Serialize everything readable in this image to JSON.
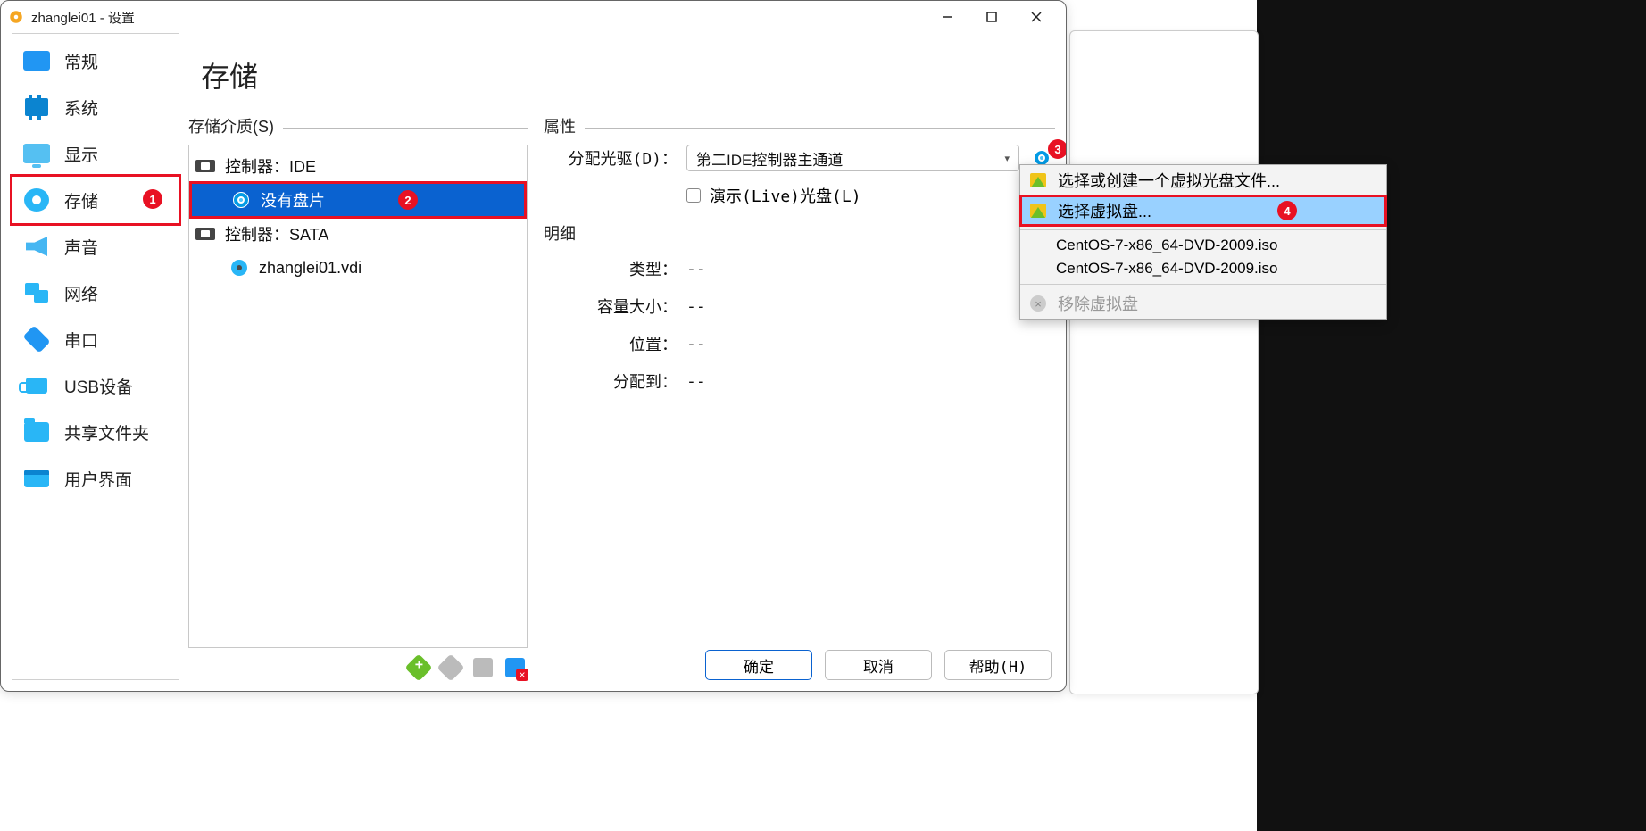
{
  "window": {
    "title": "zhanglei01 - 设置"
  },
  "sidebar": {
    "items": [
      {
        "label": "常规"
      },
      {
        "label": "系统"
      },
      {
        "label": "显示"
      },
      {
        "label": "存储"
      },
      {
        "label": "声音"
      },
      {
        "label": "网络"
      },
      {
        "label": "串口"
      },
      {
        "label": "USB设备"
      },
      {
        "label": "共享文件夹"
      },
      {
        "label": "用户界面"
      }
    ],
    "active_index": 3
  },
  "page": {
    "title": "存储"
  },
  "storage_tree": {
    "label": "存储介质(S)",
    "items": [
      {
        "label": "控制器：IDE",
        "type": "controller"
      },
      {
        "label": "没有盘片",
        "type": "disc",
        "selected": true
      },
      {
        "label": "控制器：SATA",
        "type": "controller"
      },
      {
        "label": "zhanglei01.vdi",
        "type": "hdd"
      }
    ]
  },
  "attributes": {
    "section_label": "属性",
    "drive_label": "分配光驱(D)：",
    "drive_value": "第二IDE控制器主通道",
    "live_cd_label": "演示(Live)光盘(L)"
  },
  "details": {
    "section_label": "明细",
    "rows": [
      {
        "label": "类型：",
        "value": "--"
      },
      {
        "label": "容量大小：",
        "value": "--"
      },
      {
        "label": "位置：",
        "value": "--"
      },
      {
        "label": "分配到：",
        "value": "--"
      }
    ]
  },
  "footer": {
    "ok": "确定",
    "cancel": "取消",
    "help": "帮助(H)"
  },
  "popup": {
    "create": "选择或创建一个虚拟光盘文件...",
    "choose": "选择虚拟盘...",
    "iso1": "CentOS-7-x86_64-DVD-2009.iso",
    "iso2": "CentOS-7-x86_64-DVD-2009.iso",
    "remove": "移除虚拟盘"
  },
  "markers": {
    "m1": "1",
    "m2": "2",
    "m3": "3",
    "m4": "4"
  }
}
